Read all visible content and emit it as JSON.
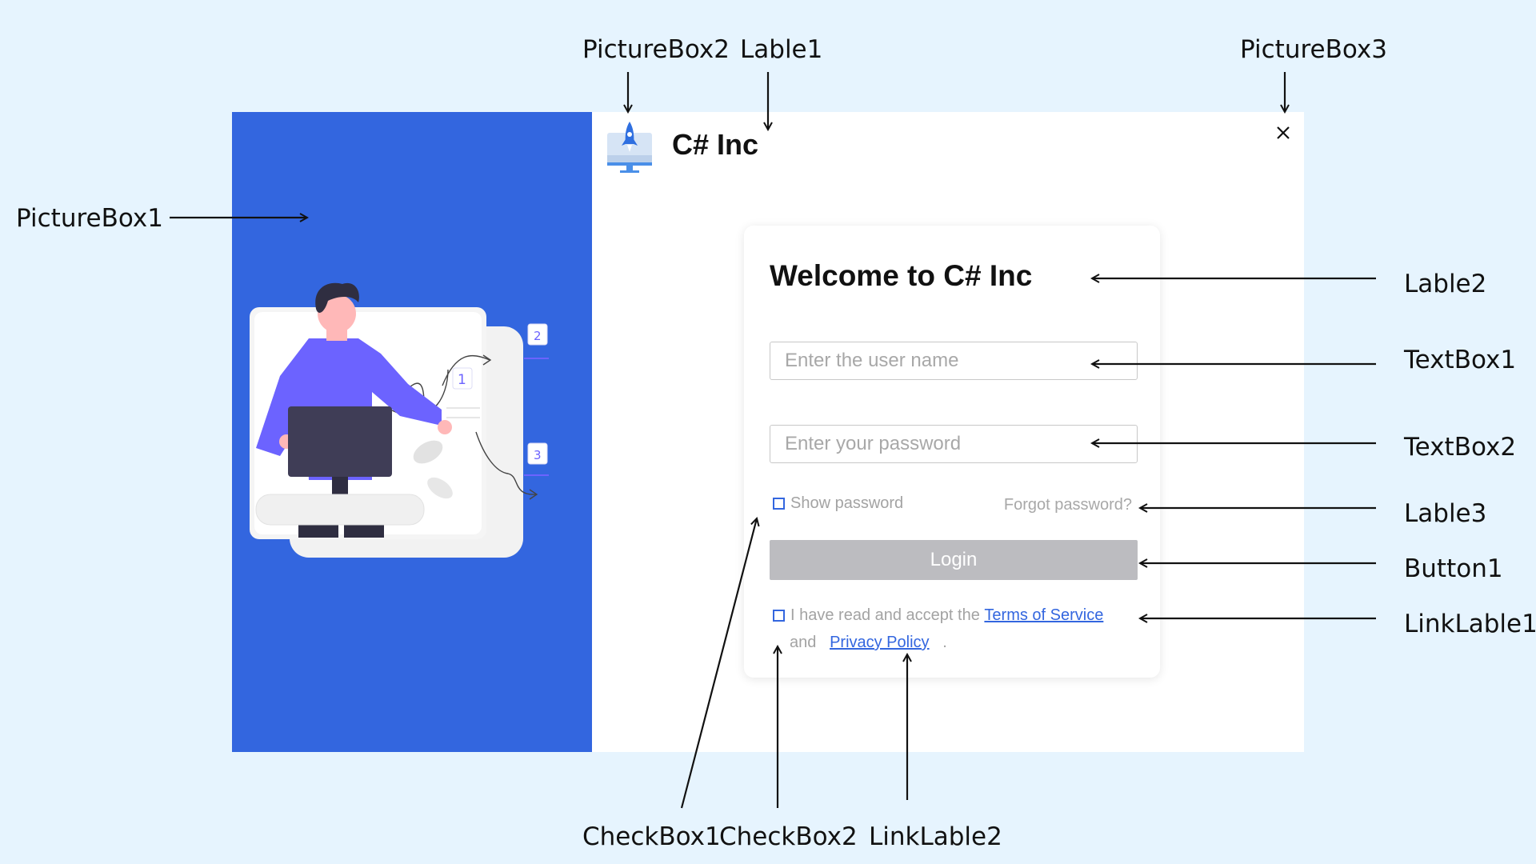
{
  "window": {
    "app_title": "C# Inc",
    "close_glyph": "×"
  },
  "login": {
    "welcome": "Welcome to C# Inc",
    "username_placeholder": "Enter the user name",
    "password_placeholder": "Enter your password",
    "show_password": "Show password",
    "forgot_password": "Forgot password?",
    "login_button": "Login",
    "terms_prefix": "I have read and accept the",
    "terms_link": "Terms of Service",
    "and": "and",
    "privacy_link": "Privacy Policy",
    "period": "."
  },
  "illustration_labels": {
    "step1": "1",
    "step2": "2",
    "step3": "3"
  },
  "callouts": {
    "picturebox1": "PictureBox1",
    "picturebox2": "PictureBox2",
    "picturebox3": "PictureBox3",
    "lable1": "Lable1",
    "lable2": "Lable2",
    "lable3": "Lable3",
    "textbox1": "TextBox1",
    "textbox2": "TextBox2",
    "button1": "Button1",
    "linklable1": "LinkLable1",
    "linklable2": "LinkLable2",
    "checkbox1": "CheckBox1",
    "checkbox2": "CheckBox2"
  },
  "colors": {
    "background": "#e6f4fe",
    "panel_blue": "#3366df",
    "button_gray": "#bcbcc0",
    "person_purple": "#6c63ff",
    "link_blue": "#3366df"
  },
  "icons": {
    "logo": "rocket-monitor-icon",
    "close": "close-icon",
    "checkbox": "checkbox-icon"
  }
}
